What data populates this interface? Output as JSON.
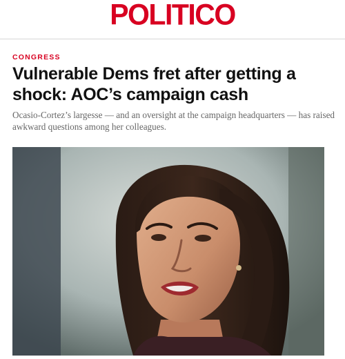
{
  "brand": {
    "logo_text": "POLITICO",
    "brand_color": "#d80021"
  },
  "article": {
    "section": "CONGRESS",
    "headline": "Vulnerable Dems fret after getting a shock: AOC’s campaign cash",
    "dek": "Ocasio-Cortez’s largesse — and an oversight at the campaign headquarters — has raised awkward questions among her colleagues."
  }
}
